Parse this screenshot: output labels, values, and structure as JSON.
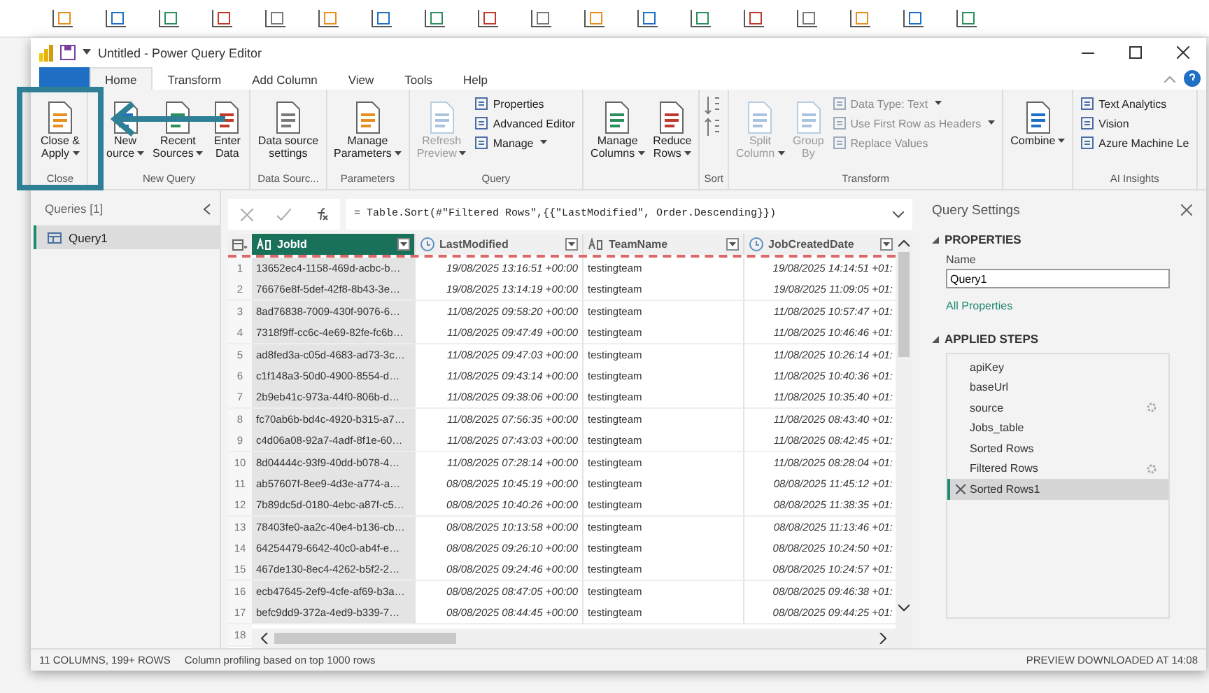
{
  "window": {
    "title": "Untitled - Power Query Editor"
  },
  "tabs": [
    {
      "kind": "file",
      "selected": false
    },
    {
      "label": "Home",
      "kind": "tab",
      "selected": true
    },
    {
      "label": "Transform",
      "kind": "tab",
      "selected": false
    },
    {
      "label": "Add Column",
      "kind": "tab",
      "selected": false
    },
    {
      "label": "View",
      "kind": "tab",
      "selected": false
    },
    {
      "label": "Tools",
      "kind": "tab",
      "selected": false
    },
    {
      "label": "Help",
      "kind": "tab",
      "selected": false
    }
  ],
  "ribbon": [
    {
      "label": "Close",
      "items": [
        {
          "kind": "large",
          "lines": [
            "Close &",
            "Apply"
          ],
          "menu": true,
          "disabled": false
        }
      ]
    },
    {
      "label": "New Query",
      "items": [
        {
          "kind": "large",
          "lines": [
            "New",
            "ource"
          ],
          "menu": true,
          "disabled": false
        },
        {
          "kind": "large",
          "lines": [
            "Recent",
            "Sources"
          ],
          "menu": true,
          "disabled": false
        },
        {
          "kind": "large",
          "lines": [
            "Enter",
            "Data"
          ],
          "menu": false,
          "disabled": false
        }
      ]
    },
    {
      "label": "Data Sourc...",
      "items": [
        {
          "kind": "large",
          "lines": [
            "Data source",
            "settings"
          ],
          "menu": false,
          "disabled": false
        }
      ]
    },
    {
      "label": "Parameters",
      "items": [
        {
          "kind": "large",
          "lines": [
            "Manage",
            "Parameters"
          ],
          "menu": true,
          "disabled": false
        }
      ]
    },
    {
      "label": "Query",
      "items": [
        {
          "kind": "large",
          "lines": [
            "Refresh",
            "Preview"
          ],
          "menu": true,
          "disabled": true
        },
        {
          "kind": "stack",
          "rows": [
            {
              "label": "Properties",
              "menu": false,
              "disabled": false
            },
            {
              "label": "Advanced Editor",
              "menu": false,
              "disabled": false
            },
            {
              "label": "Manage",
              "menu": true,
              "disabled": false
            }
          ]
        }
      ]
    },
    {
      "items": [
        {
          "kind": "large",
          "lines": [
            "Manage",
            "Columns"
          ],
          "menu": true,
          "disabled": false
        },
        {
          "kind": "large",
          "lines": [
            "Reduce",
            "Rows"
          ],
          "menu": true,
          "disabled": false
        }
      ]
    },
    {
      "label": "Sort",
      "items": [
        {
          "kind": "sort"
        }
      ]
    },
    {
      "label": "Transform",
      "items": [
        {
          "kind": "large",
          "lines": [
            "Split",
            "Column"
          ],
          "menu": true,
          "disabled": true
        },
        {
          "kind": "large",
          "lines": [
            "Group",
            "By"
          ],
          "menu": false,
          "disabled": true
        },
        {
          "kind": "stack",
          "rows": [
            {
              "label": "Data Type: Text",
              "menu": true,
              "disabled": true
            },
            {
              "label": "Use First Row as Headers",
              "menu": true,
              "disabled": true
            },
            {
              "label": "Replace Values",
              "menu": false,
              "disabled": true
            }
          ]
        }
      ]
    },
    {
      "items": [
        {
          "kind": "large",
          "lines": [
            "Combine"
          ],
          "menu": true,
          "disabled": false
        }
      ]
    },
    {
      "label": "AI Insights",
      "items": [
        {
          "kind": "stack",
          "rows": [
            {
              "label": "Text Analytics",
              "menu": false,
              "disabled": false
            },
            {
              "label": "Vision",
              "menu": false,
              "disabled": false
            },
            {
              "label": "Azure Machine Le",
              "menu": false,
              "disabled": false
            }
          ]
        }
      ]
    }
  ],
  "queries": {
    "title": "Queries [1]",
    "items": [
      {
        "label": "Query1",
        "selected": true
      }
    ]
  },
  "formula": "= Table.Sort(#\"Filtered Rows\",{{\"LastModified\", Order.Descending}})",
  "table": {
    "columns": [
      {
        "name": "JobId",
        "kind": "text",
        "selected": true
      },
      {
        "name": "LastModified",
        "kind": "datetime",
        "selected": false
      },
      {
        "name": "TeamName",
        "kind": "text",
        "selected": false
      },
      {
        "name": "JobCreatedDate",
        "kind": "datetime",
        "selected": false
      }
    ],
    "rows": [
      {
        "num": "1",
        "cells": [
          "13652ec4-1158-469d-acbc-b…",
          "19/08/2025 13:16:51 +00:00",
          "testingteam",
          "19/08/2025 14:14:51 +01:"
        ]
      },
      {
        "num": "2",
        "cells": [
          "76676e8f-5def-42f8-8b43-3e…",
          "19/08/2025 13:14:19 +00:00",
          "testingteam",
          "19/08/2025 11:09:05 +01:"
        ]
      },
      {
        "num": "3",
        "cells": [
          "8ad76838-7009-430f-9076-6…",
          "11/08/2025 09:58:20 +00:00",
          "testingteam",
          "11/08/2025 10:57:47 +01:"
        ]
      },
      {
        "num": "4",
        "cells": [
          "7318f9ff-cc6c-4e69-82fe-fc6b…",
          "11/08/2025 09:47:49 +00:00",
          "testingteam",
          "11/08/2025 10:46:46 +01:"
        ]
      },
      {
        "num": "5",
        "cells": [
          "ad8fed3a-c05d-4683-ad73-3c…",
          "11/08/2025 09:47:03 +00:00",
          "testingteam",
          "11/08/2025 10:26:14 +01:"
        ]
      },
      {
        "num": "6",
        "cells": [
          "c1f148a3-50d0-4900-8554-d…",
          "11/08/2025 09:43:14 +00:00",
          "testingteam",
          "11/08/2025 10:40:36 +01:"
        ]
      },
      {
        "num": "7",
        "cells": [
          "2b9eb41c-973a-44f0-806b-d…",
          "11/08/2025 09:38:06 +00:00",
          "testingteam",
          "11/08/2025 10:35:40 +01:"
        ]
      },
      {
        "num": "8",
        "cells": [
          "fc70ab6b-bd4c-4920-b315-a7…",
          "11/08/2025 07:56:35 +00:00",
          "testingteam",
          "11/08/2025 08:43:40 +01:"
        ]
      },
      {
        "num": "9",
        "cells": [
          "c4d06a08-92a7-4adf-8f1e-60…",
          "11/08/2025 07:43:03 +00:00",
          "testingteam",
          "11/08/2025 08:42:45 +01:"
        ]
      },
      {
        "num": "10",
        "cells": [
          "8d04444c-93f9-40dd-b078-4…",
          "11/08/2025 07:28:14 +00:00",
          "testingteam",
          "11/08/2025 08:28:04 +01:"
        ]
      },
      {
        "num": "11",
        "cells": [
          "ab57607f-8ee9-4d3e-a774-a…",
          "08/08/2025 10:45:19 +00:00",
          "testingteam",
          "08/08/2025 11:45:12 +01:"
        ]
      },
      {
        "num": "12",
        "cells": [
          "7b89dc5d-0180-4ebc-a87f-c5…",
          "08/08/2025 10:40:26 +00:00",
          "testingteam",
          "08/08/2025 11:38:35 +01:"
        ]
      },
      {
        "num": "13",
        "cells": [
          "78403fe0-aa2c-40e4-b136-cb…",
          "08/08/2025 10:13:58 +00:00",
          "testingteam",
          "08/08/2025 11:13:46 +01:"
        ]
      },
      {
        "num": "14",
        "cells": [
          "64254479-6642-40c0-ab4f-e…",
          "08/08/2025 09:26:10 +00:00",
          "testingteam",
          "08/08/2025 10:24:50 +01:"
        ]
      },
      {
        "num": "15",
        "cells": [
          "467de130-8ec4-4262-b5f2-2…",
          "08/08/2025 09:24:46 +00:00",
          "testingteam",
          "08/08/2025 10:24:57 +01:"
        ]
      },
      {
        "num": "16",
        "cells": [
          "ecb47645-2ef9-4cfe-af69-b3a…",
          "08/08/2025 08:47:05 +00:00",
          "testingteam",
          "08/08/2025 09:46:38 +01:"
        ]
      },
      {
        "num": "17",
        "cells": [
          "befc9dd9-372a-4ed9-b339-7…",
          "08/08/2025 08:44:45 +00:00",
          "testingteam",
          "08/08/2025 09:44:25 +01:"
        ]
      },
      {
        "num": "18",
        "cells": []
      }
    ]
  },
  "settings": {
    "title": "Query Settings",
    "properties_heading": "PROPERTIES",
    "name_label": "Name",
    "name_value": "Query1",
    "all_properties": "All Properties",
    "steps_heading": "APPLIED STEPS",
    "steps": [
      {
        "label": "apiKey",
        "gear": false,
        "selected": false
      },
      {
        "label": "baseUrl",
        "gear": false,
        "selected": false
      },
      {
        "label": "source",
        "gear": true,
        "selected": false
      },
      {
        "label": "Jobs_table",
        "gear": false,
        "selected": false
      },
      {
        "label": "Sorted Rows",
        "gear": false,
        "selected": false
      },
      {
        "label": "Filtered Rows",
        "gear": true,
        "selected": false
      },
      {
        "label": "Sorted Rows1",
        "gear": false,
        "selected": true
      }
    ]
  },
  "status_bar": {
    "left": "11 COLUMNS, 199+ ROWS",
    "middle": "Column profiling based on top 1000 rows",
    "right": "PREVIEW DOWNLOADED AT 14:08"
  }
}
